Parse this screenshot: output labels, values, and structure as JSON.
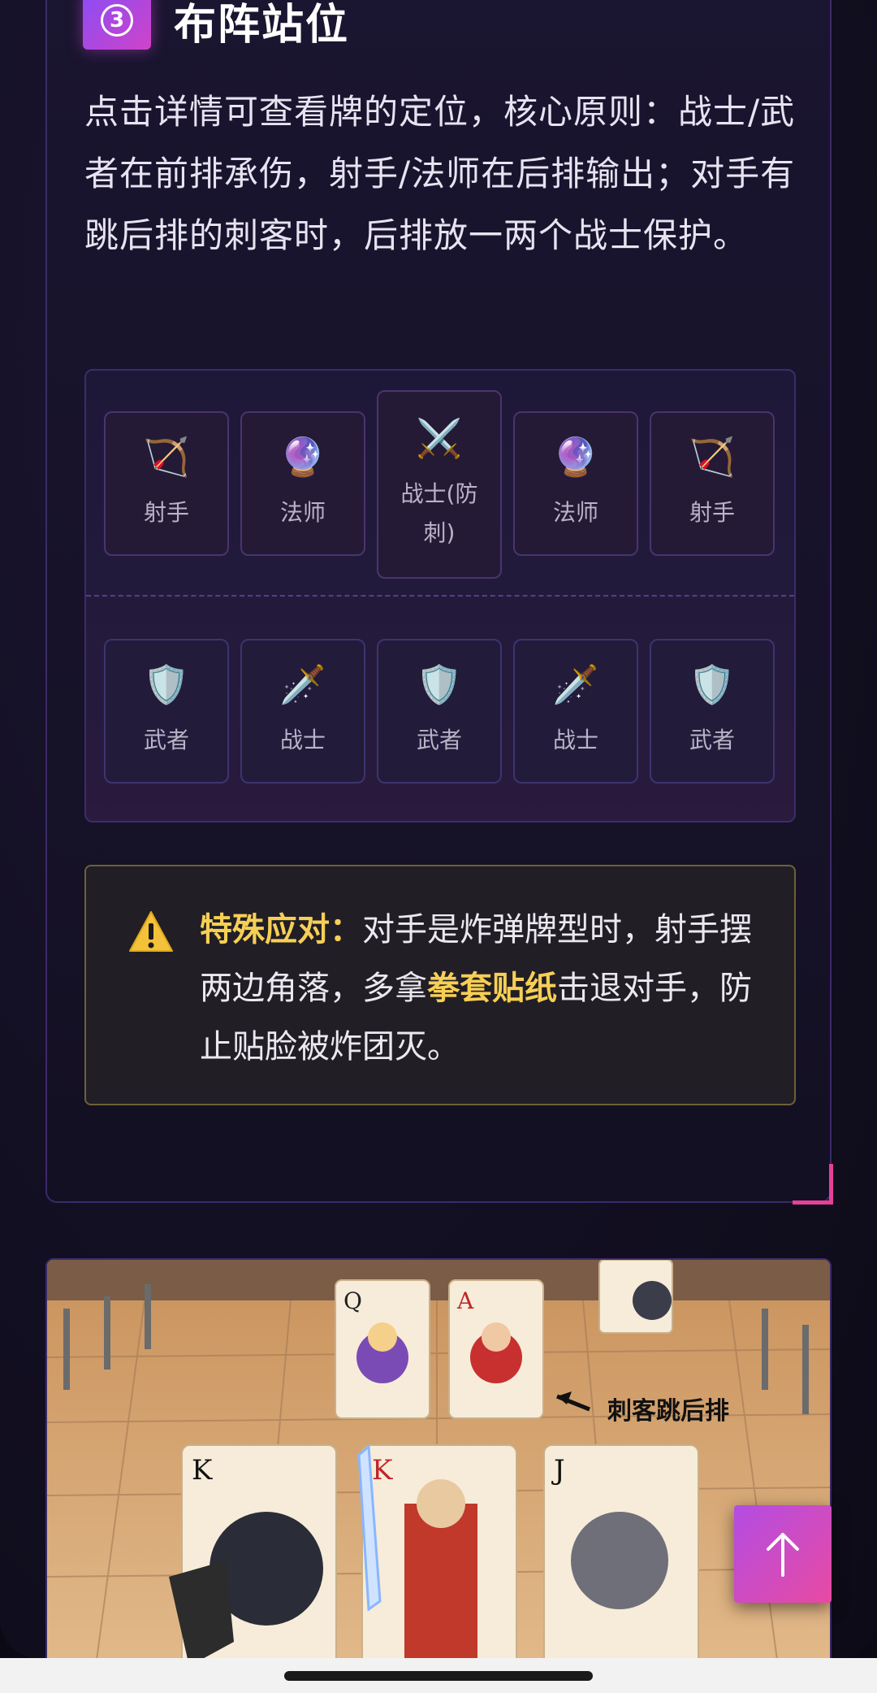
{
  "section": {
    "step_number": "3",
    "title": "布阵站位",
    "description": "点击详情可查看牌的定位，核心原则：战士/武者在前排承伤，射手/法师在后排输出；对手有跳后排的刺客时，后排放一两个战士保护。"
  },
  "formation": {
    "back_row": [
      {
        "icon": "bow-icon",
        "glyph": "🏹",
        "label": "射手"
      },
      {
        "icon": "crystal-ball-icon",
        "glyph": "🔮",
        "label": "法师"
      },
      {
        "icon": "crossed-swords-icon",
        "glyph": "⚔️",
        "label": "战士(防刺)"
      },
      {
        "icon": "crystal-ball-icon",
        "glyph": "🔮",
        "label": "法师"
      },
      {
        "icon": "bow-icon",
        "glyph": "🏹",
        "label": "射手"
      }
    ],
    "front_row": [
      {
        "icon": "shield-icon",
        "glyph": "🛡️",
        "label": "武者"
      },
      {
        "icon": "dagger-icon",
        "glyph": "🗡️",
        "label": "战士"
      },
      {
        "icon": "shield-icon",
        "glyph": "🛡️",
        "label": "武者"
      },
      {
        "icon": "dagger-icon",
        "glyph": "🗡️",
        "label": "战士"
      },
      {
        "icon": "shield-icon",
        "glyph": "🛡️",
        "label": "武者"
      }
    ]
  },
  "warning": {
    "icon": "warning-icon",
    "label": "特殊应对：",
    "text_1": "对手是炸弹牌型时，射手摆两边角落，多拿",
    "highlight": "拳套贴纸",
    "text_2": "击退对手，防止贴脸被炸团灭。"
  },
  "banner": {
    "annotation": "刺客跳后排",
    "cards": [
      "Q",
      "A",
      "K",
      "K",
      "J"
    ]
  },
  "colors": {
    "accent": "#d043c9",
    "highlight": "#f6cf55",
    "border": "#3b2a6a"
  }
}
